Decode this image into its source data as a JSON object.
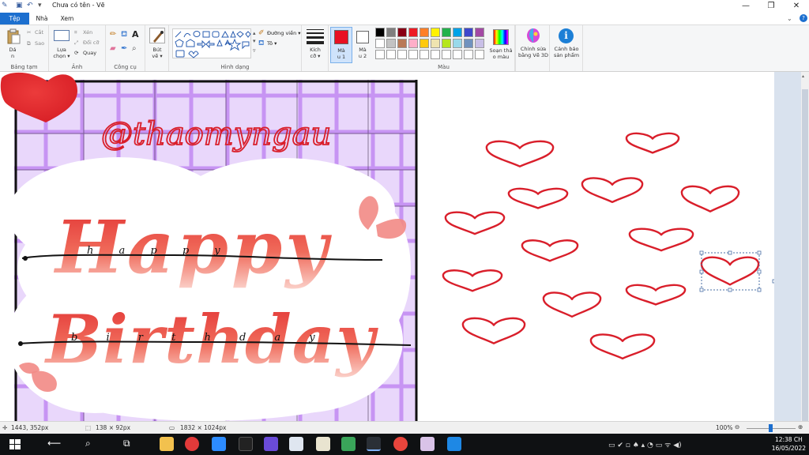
{
  "window": {
    "title": "Chưa có tên - Vẽ",
    "controls": [
      "minimize",
      "maximize",
      "close"
    ]
  },
  "tabs": [
    {
      "label": "Tệp",
      "active": true
    },
    {
      "label": "Nhà",
      "active": false
    },
    {
      "label": "Xem",
      "active": false
    }
  ],
  "ribbon": {
    "clipboard": {
      "group_label": "Bảng tạm",
      "paste": "Dá",
      "paste_sub": "n",
      "cut": "Cắt",
      "copy": "Sao"
    },
    "image": {
      "group_label": "Ảnh",
      "select": "Lựa",
      "select_sub": "chọn",
      "crop": "Xén",
      "resize": "Đổi cỡ",
      "rotate": "Quay"
    },
    "tools": {
      "group_label": "Công cụ"
    },
    "brushes": {
      "label": "Bút",
      "label_sub": "vẽ"
    },
    "shapes": {
      "group_label": "Hình dạng",
      "outline": "Đường viền",
      "fill": "Tô"
    },
    "size": {
      "label": "Kích",
      "label_sub": "cỡ"
    },
    "color1": {
      "label": "Mà",
      "label_sub": "u 1",
      "value": "#e81123"
    },
    "color2": {
      "label": "Mà",
      "label_sub": "u 2",
      "value": "#ffffff"
    },
    "colors": {
      "group_label": "Màu",
      "palette_row1": [
        "#000000",
        "#7f7f7f",
        "#880015",
        "#ed1c24",
        "#ff7f27",
        "#fff200",
        "#22b14c",
        "#00a2e8",
        "#3f48cc",
        "#a349a4"
      ],
      "palette_row2": [
        "#ffffff",
        "#c3c3c3",
        "#b97a57",
        "#ffaec9",
        "#ffc90e",
        "#efe4b0",
        "#b5e61d",
        "#99d9ea",
        "#7092be",
        "#c8bfe7"
      ],
      "palette_row3": [
        "#ffffff",
        "#ffffff",
        "#ffffff",
        "#ffffff",
        "#ffffff",
        "#ffffff",
        "#ffffff",
        "#ffffff",
        "#ffffff",
        "#ffffff"
      ]
    },
    "edit_colors": {
      "label": "Soạn thả",
      "label_sub": "o màu"
    },
    "paint3d": {
      "label": "Chỉnh sửa",
      "label_sub": "bằng Vẽ 3D"
    },
    "product_alert": {
      "label": "Cảnh báo",
      "label_sub": "sản phẩm"
    }
  },
  "canvas": {
    "watermark": "@thaomyngau",
    "heading_line1": "Happy",
    "heading_line2": "Birthday",
    "guide_line1": "h a p p y",
    "guide_line2": "b i r t h d a y",
    "heart_color": "#d91e2a"
  },
  "status": {
    "cursor_pos": "1443, 352px",
    "selection_size": "138 × 92px",
    "image_size": "1832 × 1024px",
    "zoom": "100%"
  },
  "taskbar": {
    "time": "12:38 CH",
    "date": "16/05/2022"
  }
}
